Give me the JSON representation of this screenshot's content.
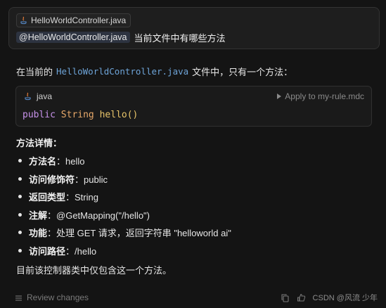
{
  "user_message": {
    "file_chip": "HelloWorldController.java",
    "mention": "@HelloWorldController.java",
    "prompt": "当前文件中有哪些方法"
  },
  "answer": {
    "intro_before": "在当前的",
    "intro_code": "HelloWorldController.java",
    "intro_after": "文件中，只有一个方法："
  },
  "code_block": {
    "language": "java",
    "apply_label": "Apply to my-rule.mdc",
    "tokens": {
      "kw": "public",
      "type": "String",
      "fn": "hello",
      "parens": "()"
    }
  },
  "details": {
    "title": "方法详情：",
    "items": [
      {
        "label": "方法名",
        "value": "：hello"
      },
      {
        "label": "访问修饰符",
        "value": "：public"
      },
      {
        "label": "返回类型",
        "value": "：String"
      },
      {
        "label": "注解",
        "value": "：@GetMapping(\"/hello\")"
      },
      {
        "label": "功能",
        "value": "：处理 GET 请求，返回字符串 \"helloworld ai\""
      },
      {
        "label": "访问路径",
        "value": "：/hello"
      }
    ]
  },
  "summary": "目前该控制器类中仅包含这一个方法。",
  "footer": {
    "review_label": "Review changes",
    "watermark": "CSDN @风流 少年"
  },
  "icons": {
    "file": "java-file-icon",
    "review": "review-changes-icon",
    "copy": "copy-icon",
    "thumbs_up": "thumbs-up-icon",
    "thumbs_down": "thumbs-down-icon"
  }
}
